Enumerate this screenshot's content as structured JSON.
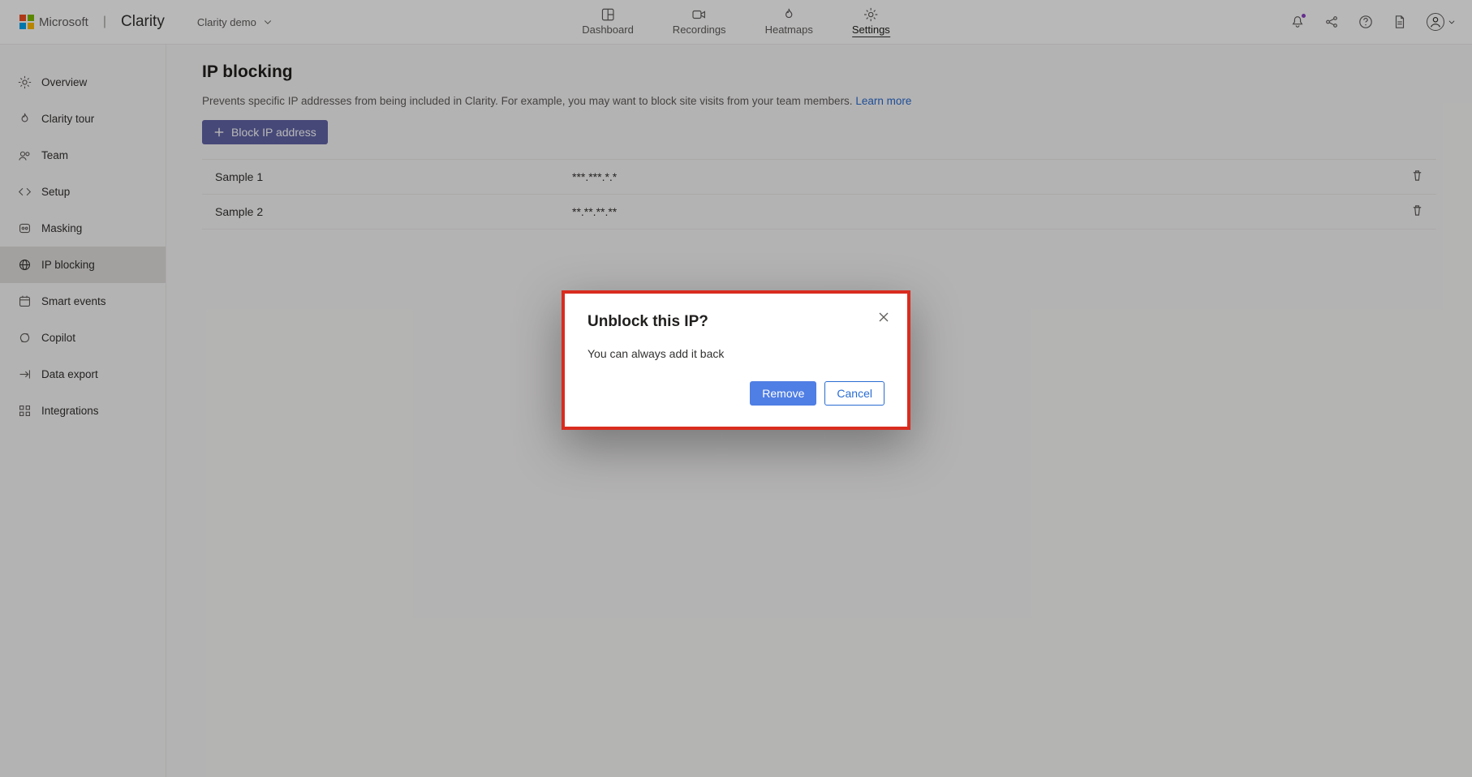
{
  "brand": {
    "ms": "Microsoft",
    "product": "Clarity"
  },
  "project_picker": {
    "label": "Clarity demo"
  },
  "top_nav": {
    "dashboard": "Dashboard",
    "recordings": "Recordings",
    "heatmaps": "Heatmaps",
    "settings": "Settings"
  },
  "sidebar": {
    "overview": "Overview",
    "tour": "Clarity tour",
    "team": "Team",
    "setup": "Setup",
    "masking": "Masking",
    "ipblocking": "IP blocking",
    "smartevents": "Smart events",
    "copilot": "Copilot",
    "dataexport": "Data export",
    "integrations": "Integrations"
  },
  "page": {
    "title": "IP blocking",
    "subtitle": "Prevents specific IP addresses from being included in Clarity. For example, you may want to block site visits from your team members. ",
    "learn_more": "Learn more",
    "block_btn": "Block IP address"
  },
  "rows": [
    {
      "name": "Sample 1",
      "ip": "***.***.*.*"
    },
    {
      "name": "Sample 2",
      "ip": "**.**.**.**"
    }
  ],
  "dialog": {
    "title": "Unblock this IP?",
    "body": "You can always add it back",
    "remove": "Remove",
    "cancel": "Cancel"
  }
}
